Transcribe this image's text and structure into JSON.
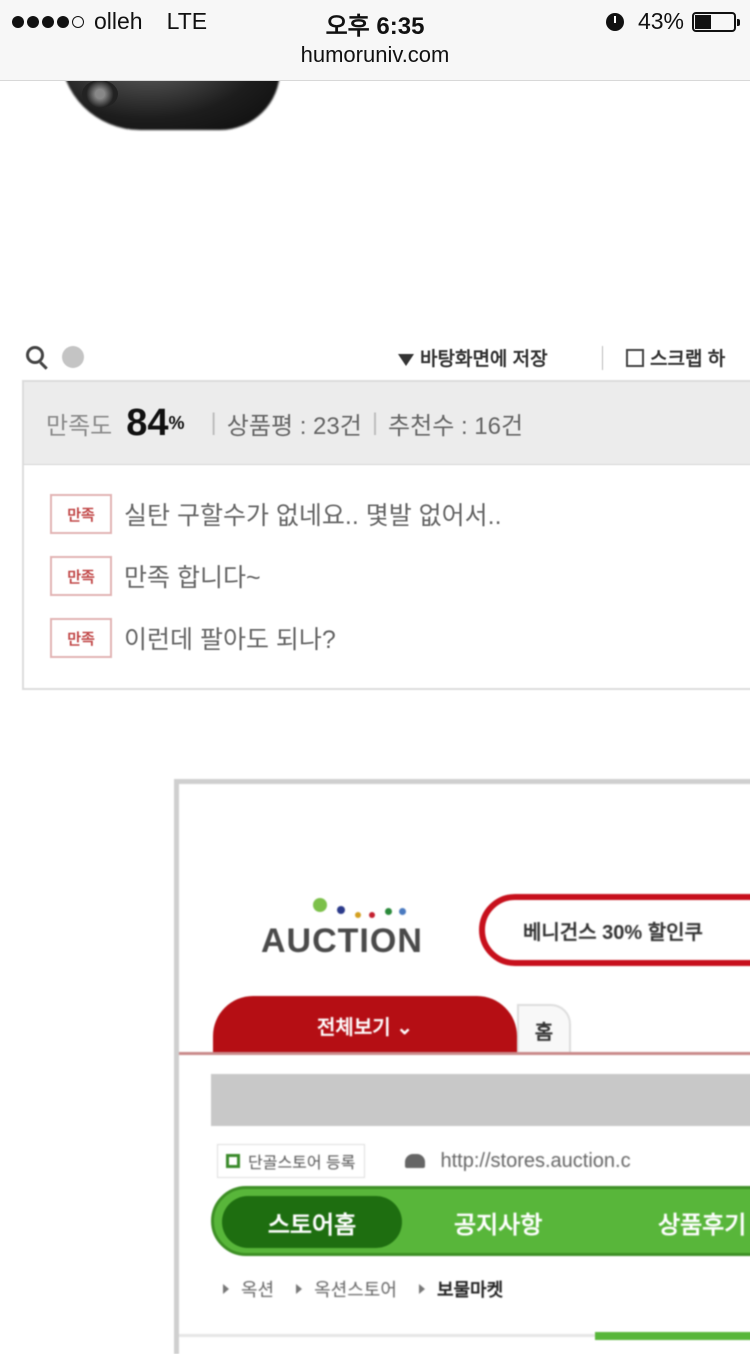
{
  "status_bar": {
    "carrier": "olleh",
    "network": "LTE",
    "time": "오후 6:35",
    "battery": "43%",
    "battery_level": 0.43,
    "signal_bars": 4,
    "signal_total": 5,
    "alarm_icon": "alarm-clock-icon"
  },
  "browser": {
    "url": "humoruniv.com"
  },
  "review_panel": {
    "save_wallpaper": "바탕화면에 저장",
    "scrap": "스크랩 하",
    "satisfaction_label": "만족도",
    "satisfaction_value": "84",
    "satisfaction_unit": "%",
    "reviews_label": "상품평 : 23건",
    "recommend_label": "추천수 : 16건",
    "reviews": [
      {
        "badge": "만족",
        "text": "실탄 구할수가 없네요.. 몇발 없어서.."
      },
      {
        "badge": "만족",
        "text": "만족 합니다~"
      },
      {
        "badge": "만족",
        "text": "이런데 팔아도 되나?"
      }
    ]
  },
  "auction": {
    "logo": "AUCTION",
    "promo_text": "베니건스 30% 할인쿠",
    "tab_all": "전체보기 ⌄",
    "tab_home": "홈",
    "favorite_btn": "단골스토어 등록",
    "store_url": "http://stores.auction.c",
    "nav": [
      "스토어홈",
      "공지사항",
      "상품후기"
    ],
    "breadcrumbs": [
      "옥션",
      "옥션스토어",
      "보물마켓"
    ],
    "colors": {
      "red": "#b50e14",
      "green": "#58b63a",
      "dark_green": "#1e6e10"
    }
  }
}
